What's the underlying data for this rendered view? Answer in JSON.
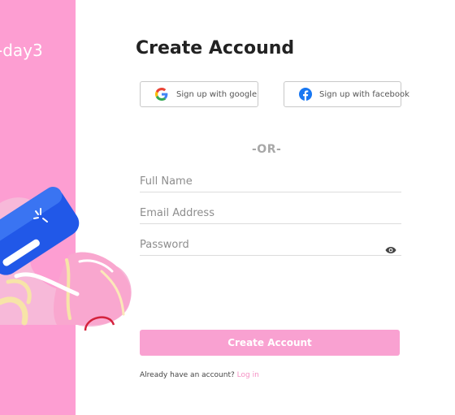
{
  "brand": {
    "text": "-day3"
  },
  "colors": {
    "accent": "#fd9ed2",
    "button": "#f9a1d1",
    "link": "#f590c4",
    "facebook": "#1877f2"
  },
  "form": {
    "title": "Create Accound",
    "social": {
      "google_label": "Sign up with google",
      "facebook_label": "Sign up with facebook"
    },
    "divider": "-OR-",
    "fields": {
      "full_name_placeholder": "Full Name",
      "email_placeholder": "Email Address",
      "password_placeholder": "Password"
    },
    "submit_label": "Create Account",
    "footer": {
      "prompt": "Already have an account?",
      "login_link": "Log in"
    }
  },
  "icons": [
    "google-icon",
    "facebook-icon",
    "eye-icon"
  ]
}
